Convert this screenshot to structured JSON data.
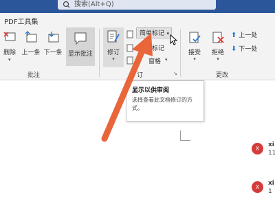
{
  "search": {
    "text": "搜索(Alt+Q)"
  },
  "tabs": {
    "pdf_tools": "PDF工具集"
  },
  "ribbon": {
    "delete": "删除",
    "prev": "上一条",
    "next": "下一条",
    "show_comments": "显示批注",
    "track_changes": "修订",
    "markup_dropdown": "简单标记",
    "show_markup": "示标记",
    "pane": "窗格",
    "accept": "接受",
    "reject": "拒绝",
    "prev_change": "上一处",
    "next_change": "下一处",
    "group_comments": "批注",
    "group_tracking": "订",
    "group_changes": "更改"
  },
  "tooltip": {
    "title": "显示以供审阅",
    "desc": "选择查看此文档修订的方式。"
  },
  "comments": [
    {
      "initial": "X",
      "name": "xi",
      "num": "11"
    },
    {
      "initial": "X",
      "name": "xi",
      "num": "1"
    }
  ],
  "colors": {
    "accent": "#2b579a",
    "arrow": "#e8663a",
    "avatar": "#d63b3b"
  }
}
